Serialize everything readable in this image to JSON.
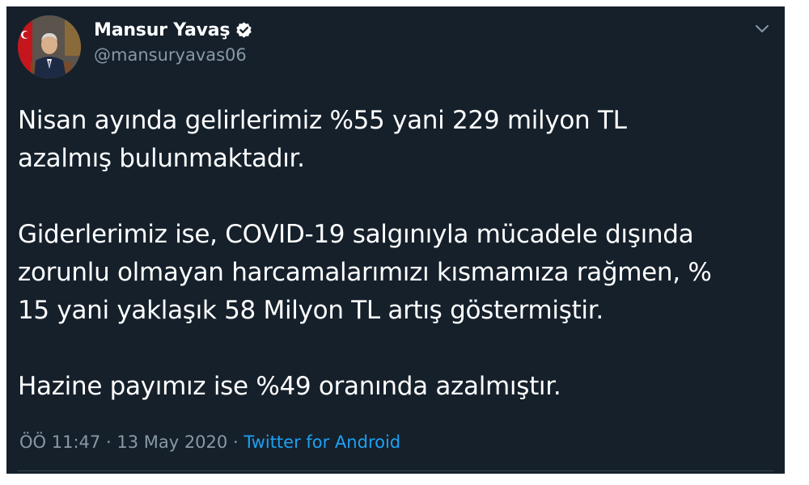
{
  "author": {
    "display_name": "Mansur Yavaş",
    "handle": "@mansuryavas06",
    "verified": true
  },
  "icons": {
    "verified": "verified-badge-icon",
    "menu": "chevron-down-icon"
  },
  "tweet": {
    "paragraphs": [
      "Nisan ayında gelirlerimiz %55 yani 229 milyon TL\nazalmış bulunmaktadır.",
      "Giderlerimiz ise, COVID-19 salgınıyla mücadele dışında\nzorunlu olmayan harcamalarımızı kısmamıza rağmen, %\n15 yani yaklaşık 58 Milyon TL artış göstermiştir.",
      "Hazine payımız ise %49 oranında azalmıştır."
    ],
    "time": "ÖÖ 11:47",
    "separator": "·",
    "date": "13 May 2020",
    "source": "Twitter for Android"
  },
  "colors": {
    "background": "#15202b",
    "text": "#ffffff",
    "secondary": "#8899a6",
    "link": "#1da1f2"
  }
}
